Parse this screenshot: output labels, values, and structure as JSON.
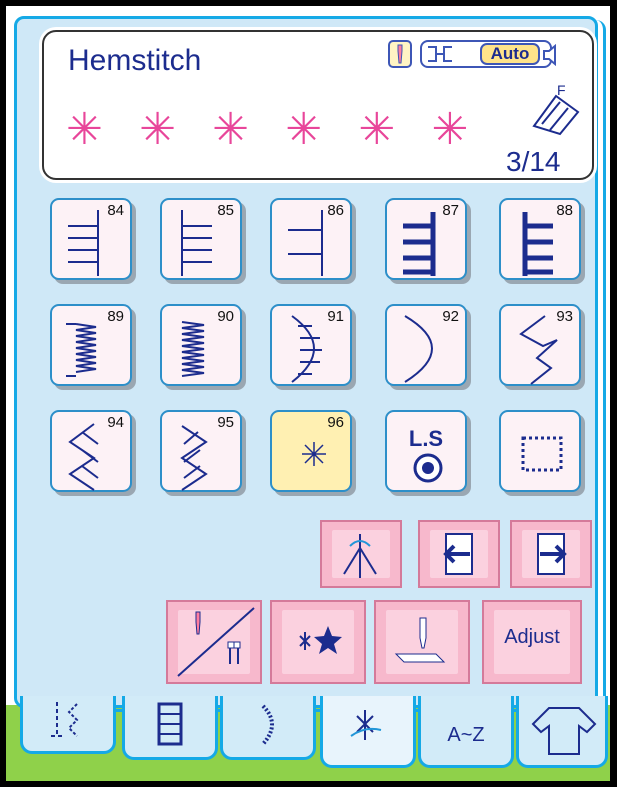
{
  "pattern_info": {
    "name": "Hemstitch",
    "preview": "✳ ✳ ✳ ✳ ✳ ✳",
    "auto_label": "Auto",
    "foot_label": "F",
    "page": "3/14"
  },
  "stitches": [
    {
      "num": "84",
      "icon": "hem-rungs-left-icon"
    },
    {
      "num": "85",
      "icon": "hem-ladder-icon"
    },
    {
      "num": "86",
      "icon": "hem-rungs-right-icon"
    },
    {
      "num": "87",
      "icon": "bold-comb-left-icon"
    },
    {
      "num": "88",
      "icon": "bold-comb-right-icon"
    },
    {
      "num": "89",
      "icon": "satin-zigzag-left-icon"
    },
    {
      "num": "90",
      "icon": "satin-zigzag-right-icon"
    },
    {
      "num": "91",
      "icon": "scallop-rungs-icon"
    },
    {
      "num": "92",
      "icon": "scallop-icon"
    },
    {
      "num": "93",
      "icon": "zigzag-icon"
    },
    {
      "num": "94",
      "icon": "feather-left-icon"
    },
    {
      "num": "95",
      "icon": "feather-right-icon"
    },
    {
      "num": "96",
      "icon": "star-stitch-icon",
      "selected": true
    },
    {
      "num": "",
      "icon": "long-stitch-icon",
      "label": "L.S"
    },
    {
      "num": "",
      "icon": "dotted-frame-icon"
    }
  ],
  "controls": {
    "adjust_label": "Adjust",
    "tabs": [
      {
        "icon": "utility-stitch-icon"
      },
      {
        "icon": "buttonhole-icon"
      },
      {
        "icon": "decorative-stitch-icon"
      },
      {
        "icon": "heirloom-stitch-icon",
        "active": true
      },
      {
        "icon": "alphabet-icon",
        "label": "A~Z"
      },
      {
        "icon": "garment-icon"
      }
    ]
  },
  "colors": {
    "frame": "#15a9e6",
    "panel": "#cfe8f7",
    "text": "#1c2c8e",
    "preview": "#e8469a",
    "selected": "#fff0b2",
    "button": "#f7b8cc"
  }
}
